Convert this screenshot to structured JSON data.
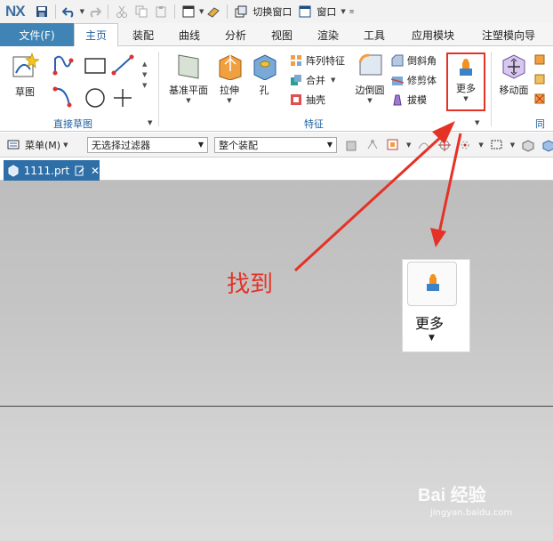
{
  "quickbar": {
    "logo": "NX",
    "switch_window": "切换窗口",
    "window_menu": "窗口"
  },
  "tabs": {
    "file": "文件(F)",
    "items": [
      "主页",
      "装配",
      "曲线",
      "分析",
      "视图",
      "渲染",
      "工具",
      "应用模块",
      "注塑模向导"
    ]
  },
  "ribbon": {
    "sketch": "草图",
    "direct_sketch_group": "直接草图",
    "datum_plane": "基准平面",
    "extrude": "拉伸",
    "hole": "孔",
    "pattern_feature": "阵列特征",
    "unite": "合并",
    "shell": "抽壳",
    "edge_blend": "边倒圆",
    "chamfer": "倒斜角",
    "trim_body": "修剪体",
    "draft": "拔模",
    "more": "更多",
    "feature_group": "特征",
    "move_face": "移动面",
    "sync_group": "同步"
  },
  "cmdbar": {
    "menu": "菜单(M)",
    "filter": "无选择过滤器",
    "scope": "整个装配"
  },
  "document": {
    "tab_name": "1111.prt"
  },
  "annotation": {
    "find_text": "找到",
    "zoom_label": "更多"
  },
  "watermark": {
    "brand": "Bai 经验",
    "url": "jingyan.baidu.com"
  },
  "colors": {
    "accent_blue": "#3f84b5",
    "highlight_red": "#e53226"
  }
}
